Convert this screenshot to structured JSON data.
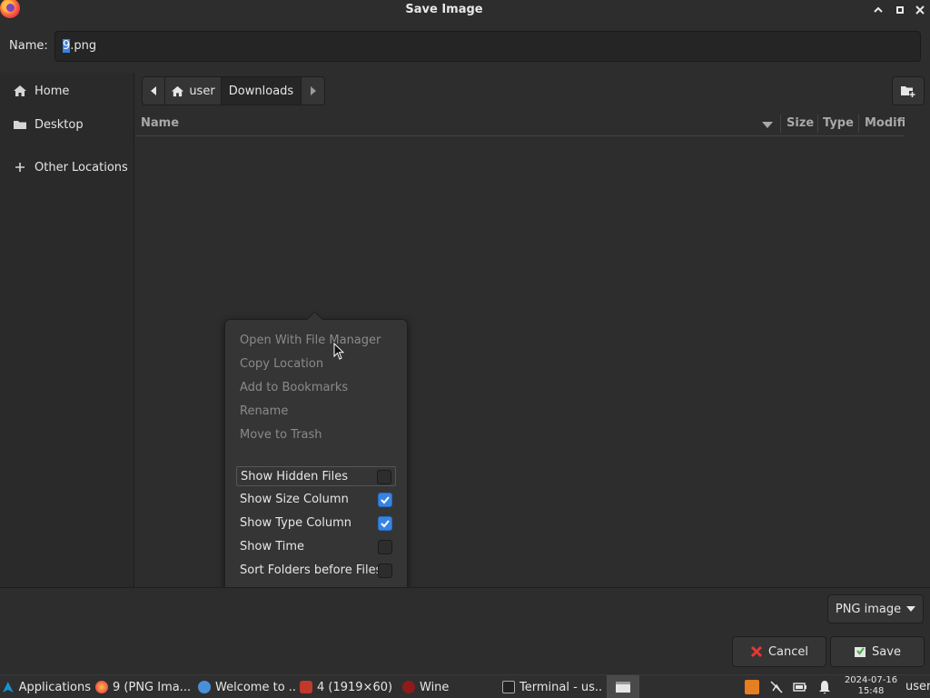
{
  "dialog": {
    "title": "Save Image",
    "name_label": "Name:",
    "filename_selected": "9",
    "filename_rest": ".png"
  },
  "sidebar": {
    "items": [
      {
        "label": "Home",
        "icon": "home-icon"
      },
      {
        "label": "Desktop",
        "icon": "folder-icon"
      },
      {
        "label": "Other Locations",
        "icon": "plus-icon"
      }
    ]
  },
  "pathbar": {
    "segments": [
      {
        "label": "user",
        "icon": "home-icon"
      },
      {
        "label": "Downloads"
      }
    ]
  },
  "filelist": {
    "columns": [
      "Name",
      "Size",
      "Type",
      "Modifie"
    ]
  },
  "context_menu": {
    "disabled_items": [
      "Open With File Manager",
      "Copy Location",
      "Add to Bookmarks",
      "Rename",
      "Move to Trash"
    ],
    "toggles": [
      {
        "label": "Show Hidden Files",
        "checked": false
      },
      {
        "label": "Show Size Column",
        "checked": true
      },
      {
        "label": "Show Type Column",
        "checked": true
      },
      {
        "label": "Show Time",
        "checked": false
      },
      {
        "label": "Sort Folders before Files",
        "checked": false
      }
    ]
  },
  "footer": {
    "filter": "PNG image",
    "cancel": "Cancel",
    "save": "Save"
  },
  "taskbar": {
    "applications": "Applications",
    "tasks": [
      "9 (PNG Ima...",
      "Welcome to ...",
      "4 (1919×60) ...",
      "Wine",
      "Terminal - us..."
    ],
    "date": "2024-07-16",
    "time": "15:48",
    "user": "user"
  },
  "colors": {
    "accent": "#3584e4",
    "background": "#2d2d2d",
    "cancel_icon": "#e53935",
    "save_icon": "#4caf50"
  }
}
